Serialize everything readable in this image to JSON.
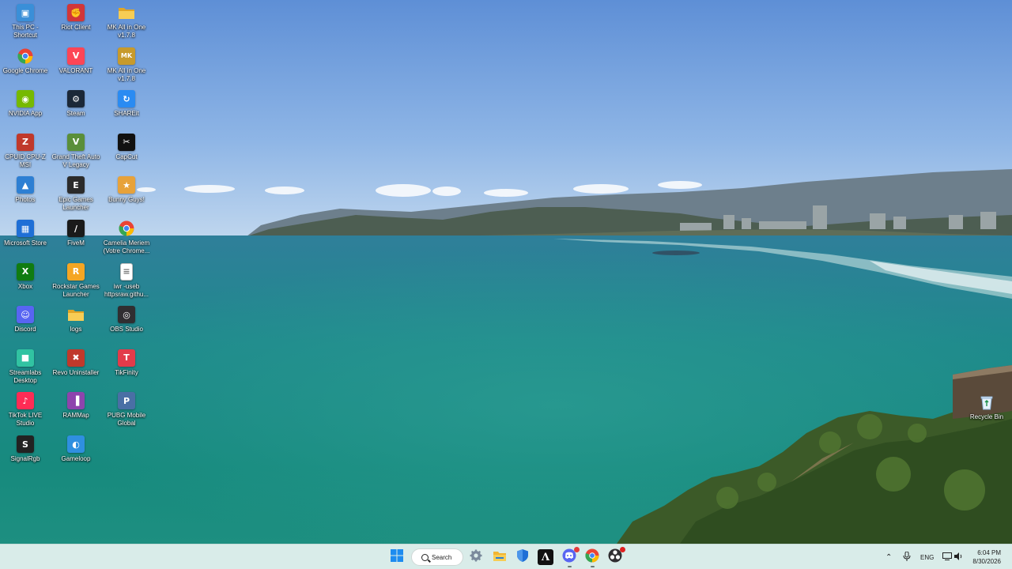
{
  "desktop": {
    "icons": [
      {
        "label": "This PC - Shortcut",
        "icon": "computer-icon",
        "color": "#3a8fd8"
      },
      {
        "label": "Riot Client",
        "icon": "riot-client-icon",
        "color": "#d13639"
      },
      {
        "label": "MK All in One v1.7.8",
        "icon": "folder-icon",
        "color": "#f2c14e"
      },
      {
        "label": "Google Chrome",
        "icon": "chrome-icon",
        "color": "#ea4335"
      },
      {
        "label": "VALORANT",
        "icon": "valorant-icon",
        "color": "#fd4556"
      },
      {
        "label": "MK All in One v1.7.8",
        "icon": "mk-app-icon",
        "color": "#c79a2c"
      },
      {
        "label": "NVIDIA App",
        "icon": "nvidia-icon",
        "color": "#76b900"
      },
      {
        "label": "Steam",
        "icon": "steam-icon",
        "color": "#1b2838"
      },
      {
        "label": "SHAREit",
        "icon": "shareit-icon",
        "color": "#2a8bf2"
      },
      {
        "label": "CPUID CPU-Z MSI",
        "icon": "cpuz-icon",
        "color": "#c0392b"
      },
      {
        "label": "Grand Theft Auto V Legacy",
        "icon": "gta-icon",
        "color": "#5a8f3a"
      },
      {
        "label": "CapCut",
        "icon": "capcut-icon",
        "color": "#111111"
      },
      {
        "label": "Photos",
        "icon": "photos-icon",
        "color": "#2d7fd3"
      },
      {
        "label": "Epic Games Launcher",
        "icon": "epic-games-icon",
        "color": "#2b2b2b"
      },
      {
        "label": "Bunny Guys!",
        "icon": "bunny-guys-icon",
        "color": "#e7a23a"
      },
      {
        "label": "Microsoft Store",
        "icon": "store-icon",
        "color": "#1f6fd6"
      },
      {
        "label": "FiveM",
        "icon": "fivem-icon",
        "color": "#1a1a1a"
      },
      {
        "label": "Camelia Meriem (Votre Chrome...",
        "icon": "chrome-profile-icon",
        "color": "#ea4335"
      },
      {
        "label": "Xbox",
        "icon": "xbox-icon",
        "color": "#107c10"
      },
      {
        "label": "Rockstar Games Launcher",
        "icon": "rockstar-icon",
        "color": "#f5a623"
      },
      {
        "label": "iwr -useb httpsraw.githu...",
        "icon": "text-file-icon",
        "color": "#ffffff"
      },
      {
        "label": "Discord",
        "icon": "discord-icon",
        "color": "#5865f2"
      },
      {
        "label": "logs",
        "icon": "folder-icon",
        "color": "#f2c14e"
      },
      {
        "label": "OBS Studio",
        "icon": "obs-icon",
        "color": "#302e31"
      },
      {
        "label": "Streamlabs Desktop",
        "icon": "streamlabs-icon",
        "color": "#31c3a2"
      },
      {
        "label": "Revo Uninstaller",
        "icon": "revo-icon",
        "color": "#c0392b"
      },
      {
        "label": "TikFinity",
        "icon": "tikfinity-icon",
        "color": "#e23b4a"
      },
      {
        "label": "TikTok LIVE Studio",
        "icon": "tiktok-icon",
        "color": "#fe2c55"
      },
      {
        "label": "RAMMap",
        "icon": "rammap-icon",
        "color": "#8e44ad"
      },
      {
        "label": "PUBG Mobile Global",
        "icon": "pubg-icon",
        "color": "#4a6fa5"
      },
      {
        "label": "SignalRgb",
        "icon": "signalrgb-icon",
        "color": "#222222"
      },
      {
        "label": "Gameloop",
        "icon": "gameloop-icon",
        "color": "#2f8fe0"
      }
    ],
    "recycle_bin": {
      "label": "Recycle Bin",
      "icon": "recycle-bin-icon"
    }
  },
  "taskbar": {
    "search_label": "Search",
    "apps": [
      {
        "name": "start-button",
        "icon": "windows-icon",
        "color": "#1d8cf0"
      },
      {
        "name": "settings-button",
        "icon": "gear-icon",
        "color": "#5d6d7e"
      },
      {
        "name": "file-explorer-button",
        "icon": "folder-icon",
        "color": "#f2b632"
      },
      {
        "name": "security-button",
        "icon": "shield-icon",
        "color": "#1f6fd6"
      },
      {
        "name": "app-a-button",
        "icon": "a-logo-icon",
        "color": "#111111"
      },
      {
        "name": "discord-button",
        "icon": "discord-icon",
        "color": "#5865f2"
      },
      {
        "name": "chrome-button",
        "icon": "chrome-icon",
        "color": "#ea4335"
      },
      {
        "name": "obs-button",
        "icon": "obs-icon",
        "color": "#302e31"
      }
    ],
    "tray": {
      "language": "ENG",
      "time": "6:04 PM",
      "date": "8/30/2026"
    }
  }
}
